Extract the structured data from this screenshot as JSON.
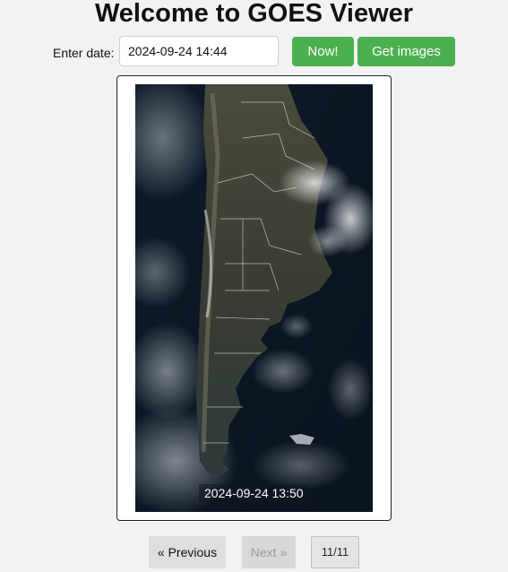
{
  "header": {
    "title": "Welcome to GOES Viewer"
  },
  "controls": {
    "date_label": "Enter date:",
    "date_value": "2024-09-24 14:44",
    "now_label": "Now!",
    "get_images_label": "Get images"
  },
  "viewer": {
    "timestamp": "2024-09-24 13:50"
  },
  "pagination": {
    "previous_label": "« Previous",
    "next_label": "Next »",
    "counter": "11/11",
    "next_disabled": true
  },
  "colors": {
    "button_green": "#4cb050",
    "page_background": "#f2f2f2",
    "ocean": "#0d1726"
  }
}
